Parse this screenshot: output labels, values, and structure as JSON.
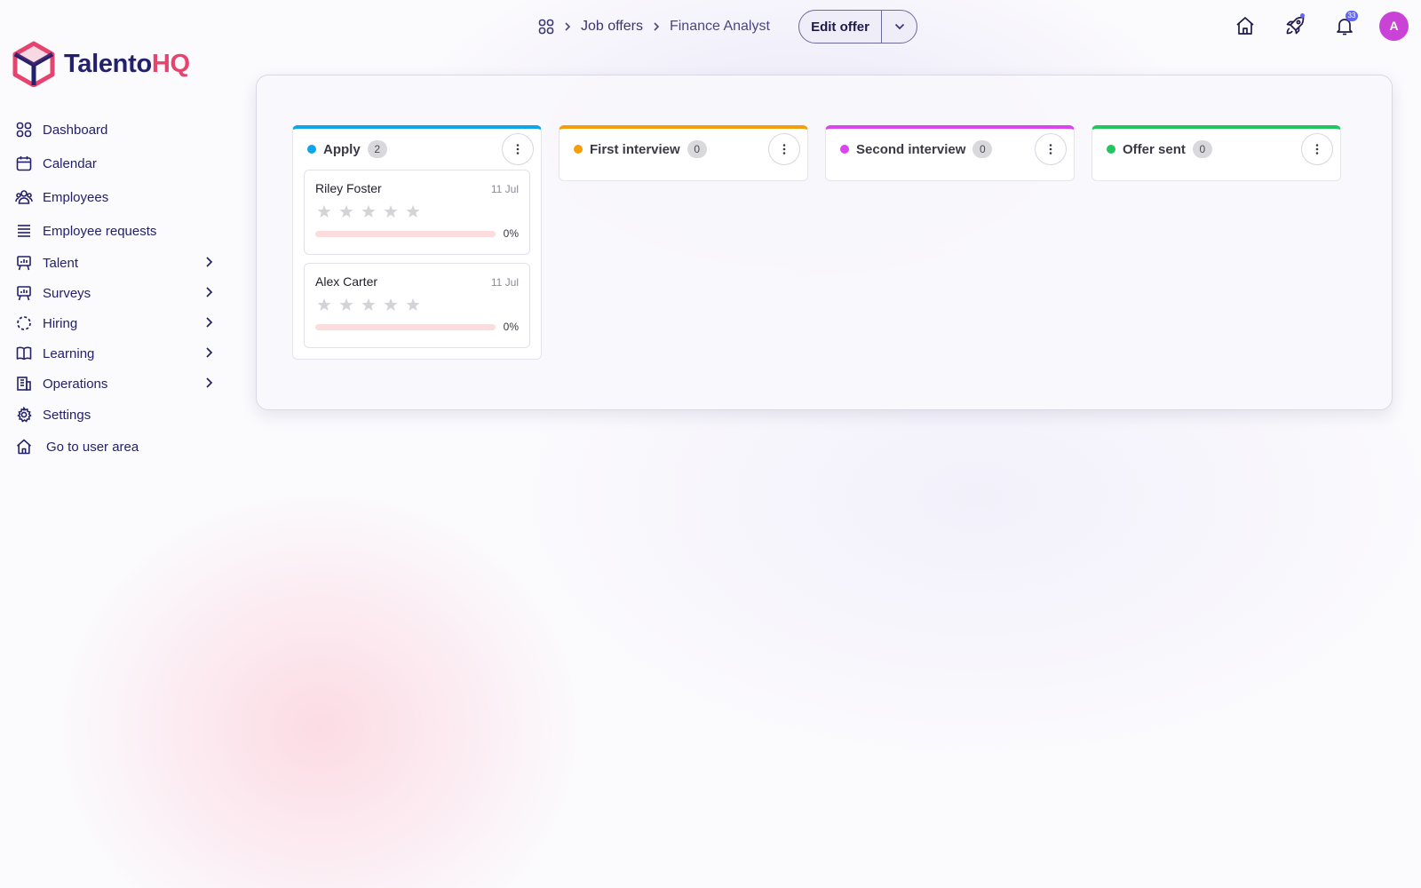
{
  "brand": {
    "name_part1": "Talento",
    "name_part2": "HQ"
  },
  "breadcrumb": {
    "items": [
      "Job offers",
      "Finance Analyst"
    ]
  },
  "actions": {
    "edit_label": "Edit offer"
  },
  "header": {
    "notifications_count": "33",
    "avatar_initial": "A"
  },
  "sidebar": {
    "items": [
      {
        "label": "Dashboard",
        "icon": "dashboard-icon"
      },
      {
        "label": "Calendar",
        "icon": "calendar-icon"
      },
      {
        "label": "Employees",
        "icon": "users-icon"
      },
      {
        "label": "Employee requests",
        "icon": "list-icon"
      },
      {
        "label": "Talent",
        "icon": "presentation-icon",
        "expandable": true
      },
      {
        "label": "Surveys",
        "icon": "presentation-icon",
        "expandable": true
      },
      {
        "label": "Hiring",
        "icon": "dashed-circle-icon",
        "expandable": true
      },
      {
        "label": "Learning",
        "icon": "book-icon",
        "expandable": true
      },
      {
        "label": "Operations",
        "icon": "building-icon",
        "expandable": true
      },
      {
        "label": "Settings",
        "icon": "gear-icon"
      },
      {
        "label": "Go to user area",
        "icon": "home-icon"
      }
    ]
  },
  "pipeline": {
    "columns": [
      {
        "title": "Apply",
        "count": "2",
        "color": "#0ea5e9",
        "cards": [
          {
            "name": "Riley Foster",
            "date": "11 Jul",
            "rating": 0,
            "progress": 0,
            "progress_label": "0%"
          },
          {
            "name": "Alex Carter",
            "date": "11 Jul",
            "rating": 0,
            "progress": 0,
            "progress_label": "0%"
          }
        ]
      },
      {
        "title": "First interview",
        "count": "0",
        "color": "#f59e0b",
        "cards": []
      },
      {
        "title": "Second interview",
        "count": "0",
        "color": "#d946ef",
        "cards": []
      },
      {
        "title": "Offer sent",
        "count": "0",
        "color": "#22c55e",
        "cards": []
      }
    ]
  }
}
